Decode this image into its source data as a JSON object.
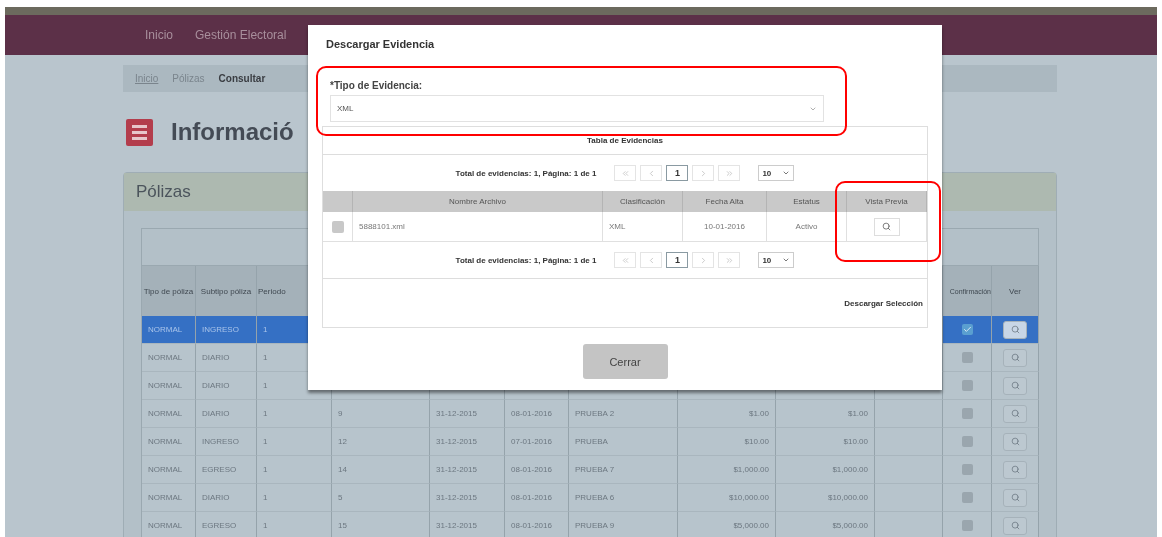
{
  "navbar": {
    "items": [
      "Inicio",
      "Gestión Electoral"
    ]
  },
  "breadcrumb": [
    {
      "label": "Inicio",
      "kind": "link"
    },
    {
      "label": "Pólizas",
      "kind": "link"
    },
    {
      "label": "Consultar",
      "kind": "current"
    }
  ],
  "page_title": "Informació",
  "panel": {
    "title": "Pólizas",
    "columns": [
      "Tipo de póliza",
      "Subtipo póliza",
      "Periodo",
      null,
      null,
      null,
      null,
      null,
      null,
      null,
      "Confirmación",
      "Ver"
    ],
    "rows": [
      {
        "selected": true,
        "checked": true,
        "cells": [
          "NORMAL",
          "INGRESO",
          "1",
          null,
          null,
          null,
          null,
          null,
          null,
          null
        ]
      },
      {
        "selected": false,
        "checked": false,
        "cells": [
          "NORMAL",
          "DIARIO",
          "1",
          null,
          null,
          null,
          null,
          null,
          null,
          null
        ]
      },
      {
        "selected": false,
        "checked": false,
        "cells": [
          "NORMAL",
          "DIARIO",
          "1",
          null,
          null,
          null,
          null,
          null,
          null,
          null
        ]
      },
      {
        "selected": false,
        "checked": false,
        "cells": [
          "NORMAL",
          "DIARIO",
          "1",
          "9",
          "31-12-2015",
          "08-01-2016",
          "PRUEBA 2",
          "$1.00",
          "$1.00",
          null
        ]
      },
      {
        "selected": false,
        "checked": false,
        "cells": [
          "NORMAL",
          "INGRESO",
          "1",
          "12",
          "31-12-2015",
          "07-01-2016",
          "PRUEBA",
          "$10.00",
          "$10.00",
          null
        ]
      },
      {
        "selected": false,
        "checked": false,
        "cells": [
          "NORMAL",
          "EGRESO",
          "1",
          "14",
          "31-12-2015",
          "08-01-2016",
          "PRUEBA 7",
          "$1,000.00",
          "$1,000.00",
          null
        ]
      },
      {
        "selected": false,
        "checked": false,
        "cells": [
          "NORMAL",
          "DIARIO",
          "1",
          "5",
          "31-12-2015",
          "08-01-2016",
          "PRUEBA 6",
          "$10,000.00",
          "$10,000.00",
          null
        ]
      },
      {
        "selected": false,
        "checked": false,
        "cells": [
          "NORMAL",
          "EGRESO",
          "1",
          "15",
          "31-12-2015",
          "08-01-2016",
          "PRUEBA 9",
          "$5,000.00",
          "$5,000.00",
          null
        ]
      }
    ]
  },
  "modal": {
    "title": "Descargar Evidencia",
    "field_label": "*Tipo de Evidencia:",
    "field_value": "XML",
    "table_title": "Tabla de Evidencias",
    "pagers": [
      {
        "summary": "Total de evidencias: 1, Página: 1 de 1",
        "page": "1",
        "page_size": "10"
      },
      {
        "summary": "Total de evidencias: 1, Página: 1 de 1",
        "page": "1",
        "page_size": "10"
      }
    ],
    "columns": [
      "Nombre Archivo",
      "Clasificación",
      "Fecha Alta",
      "Estatus",
      "Vista Previa"
    ],
    "rows": [
      {
        "checked": false,
        "cells": [
          "5888101.xml",
          "XML",
          "10-01-2016",
          "Activo"
        ]
      }
    ],
    "download": "Descargar Selección",
    "close": "Cerrar"
  }
}
